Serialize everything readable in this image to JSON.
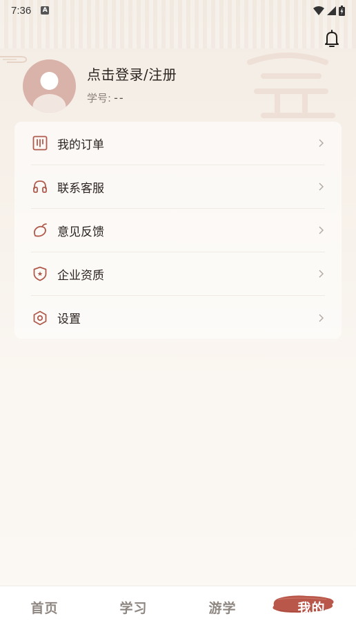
{
  "status_bar": {
    "time": "7:36",
    "a_badge": "A"
  },
  "header": {
    "bell_icon": "bell-icon"
  },
  "profile": {
    "login_text": "点击登录/注册",
    "student_label": "学号:",
    "student_value": "--"
  },
  "menu": {
    "items": [
      {
        "label": "我的订单",
        "icon": "order-icon"
      },
      {
        "label": "联系客服",
        "icon": "headset-icon"
      },
      {
        "label": "意见反馈",
        "icon": "feedback-icon"
      },
      {
        "label": "企业资质",
        "icon": "shield-icon"
      },
      {
        "label": "设置",
        "icon": "settings-icon"
      }
    ]
  },
  "tabs": [
    {
      "label": "首页",
      "active": false
    },
    {
      "label": "学习",
      "active": false
    },
    {
      "label": "游学",
      "active": false
    },
    {
      "label": "我的",
      "active": true
    }
  ],
  "colors": {
    "accent": "#b9574a",
    "icon": "#b05a4c",
    "avatar": "#d9b3a9",
    "tab_inactive": "#8e8680"
  }
}
